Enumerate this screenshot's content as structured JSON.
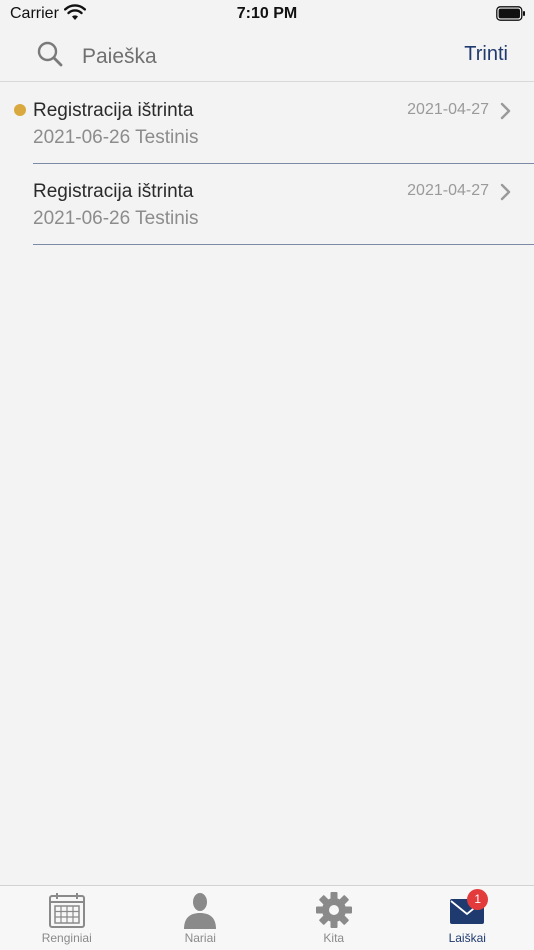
{
  "status_bar": {
    "carrier": "Carrier",
    "time": "7:10 PM"
  },
  "search": {
    "placeholder": "Paieška",
    "value": "",
    "delete_label": "Trinti"
  },
  "messages": [
    {
      "title": "Registracija ištrinta",
      "subtitle": "2021-06-26 Testinis",
      "date": "2021-04-27",
      "unread": false
    },
    {
      "title": "Registracija ištrinta",
      "subtitle": "2021-06-26 Testinis",
      "date": "2021-04-27",
      "unread": true
    }
  ],
  "tabs": [
    {
      "label": "Renginiai",
      "icon": "calendar-icon",
      "active": false
    },
    {
      "label": "Nariai",
      "icon": "person-icon",
      "active": false
    },
    {
      "label": "Kita",
      "icon": "gear-icon",
      "active": false
    },
    {
      "label": "Laiškai",
      "icon": "mail-icon",
      "active": true,
      "badge": "1"
    }
  ],
  "colors": {
    "accent": "#1f3a6e",
    "unread_dot": "#d9a93f",
    "badge": "#e33b3b",
    "divider": "#7d8aa6"
  }
}
